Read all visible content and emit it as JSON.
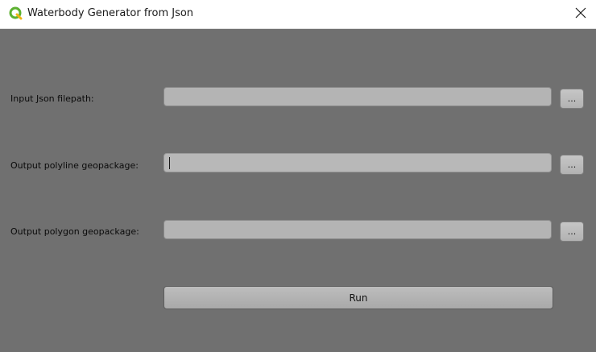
{
  "window": {
    "title": "Waterbody Generator from Json",
    "icon": "qgis-logo-icon",
    "close_icon": "close-icon"
  },
  "form": {
    "fields": [
      {
        "label": "Input Json filepath:",
        "value": "",
        "browse_label": "..."
      },
      {
        "label": "Output polyline geopackage:",
        "value": "",
        "browse_label": "..."
      },
      {
        "label": "Output polygon geopackage:",
        "value": "",
        "browse_label": "..."
      }
    ],
    "run_label": "Run"
  },
  "colors": {
    "background": "#707070",
    "input_bg": "#b4b4b4",
    "qgis_green": "#5cb130"
  }
}
